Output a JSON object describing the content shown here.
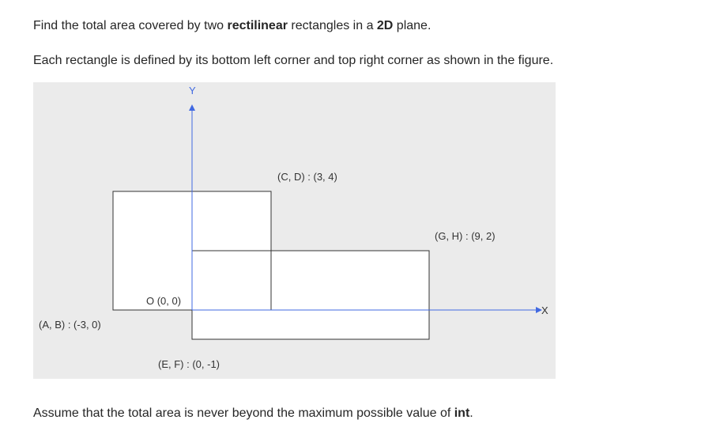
{
  "paragraphs": {
    "p1": {
      "before": "Find the total area covered by two ",
      "bold1": "rectilinear",
      "middle": " rectangles in a ",
      "bold2": "2D",
      "after": " plane."
    },
    "p2": {
      "text": "Each rectangle is defined by its bottom left corner and top right corner as shown in the figure."
    },
    "p3": {
      "before": "Assume that the total area is never beyond the maximum possible value of ",
      "bold": "int",
      "after": "."
    }
  },
  "figure": {
    "y_axis_label": "Y",
    "x_axis_label": "X",
    "origin_label": "O (0, 0)",
    "label_AB": "(A, B) : (-3, 0)",
    "label_CD": "(C, D) : (3, 4)",
    "label_EF": "(E, F) : (0, -1)",
    "label_GH": "(G, H) : (9, 2)",
    "axis_color": "#4169e1",
    "rect_stroke_color": "#333333",
    "rect_fill_color": "#ffffff",
    "background_color": "#ebebeb"
  }
}
